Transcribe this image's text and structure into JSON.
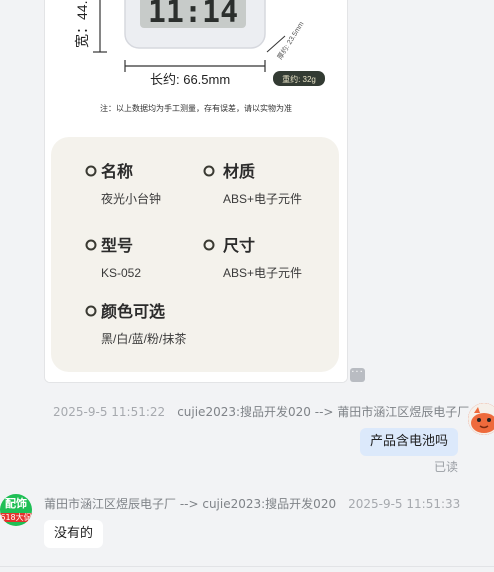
{
  "product_image": {
    "vertical_dim_label": "宽：44.",
    "display_digits": "11:14",
    "length_label": "长约: 66.5mm",
    "thickness_label": "厚约: 23.5mm",
    "weight_label": "重约: 32g",
    "disclaimer": "注：以上数据均为手工测量，存有误差，请以实物为准",
    "specs": [
      {
        "title": "名称",
        "value": "夜光小台钟"
      },
      {
        "title": "材质",
        "value": "ABS+电子元件"
      },
      {
        "title": "型号",
        "value": "KS-052"
      },
      {
        "title": "尺寸",
        "value": "ABS+电子元件"
      },
      {
        "title": "颜色可选",
        "value": "黑/白/蓝/粉/抹茶"
      }
    ]
  },
  "more_icon_label": "···",
  "messages": [
    {
      "time": "2025-9-5 11:51:22",
      "from_to": "cujie2023:搜品开发020 --> 莆田市涵江区煜辰电子厂",
      "text": "产品含电池吗",
      "status": "已读"
    },
    {
      "time": "2025-9-5 11:51:33",
      "from_to": "莆田市涵江区煜辰电子厂 --> cujie2023:搜品开发020",
      "text": "没有的",
      "avatar_text_top": "配饰",
      "avatar_text_bottom": "618大促"
    }
  ],
  "colors": {
    "accent_green": "#1fbf55",
    "my_bubble": "#dce9fb",
    "panel_beige": "#f4f2ec"
  }
}
